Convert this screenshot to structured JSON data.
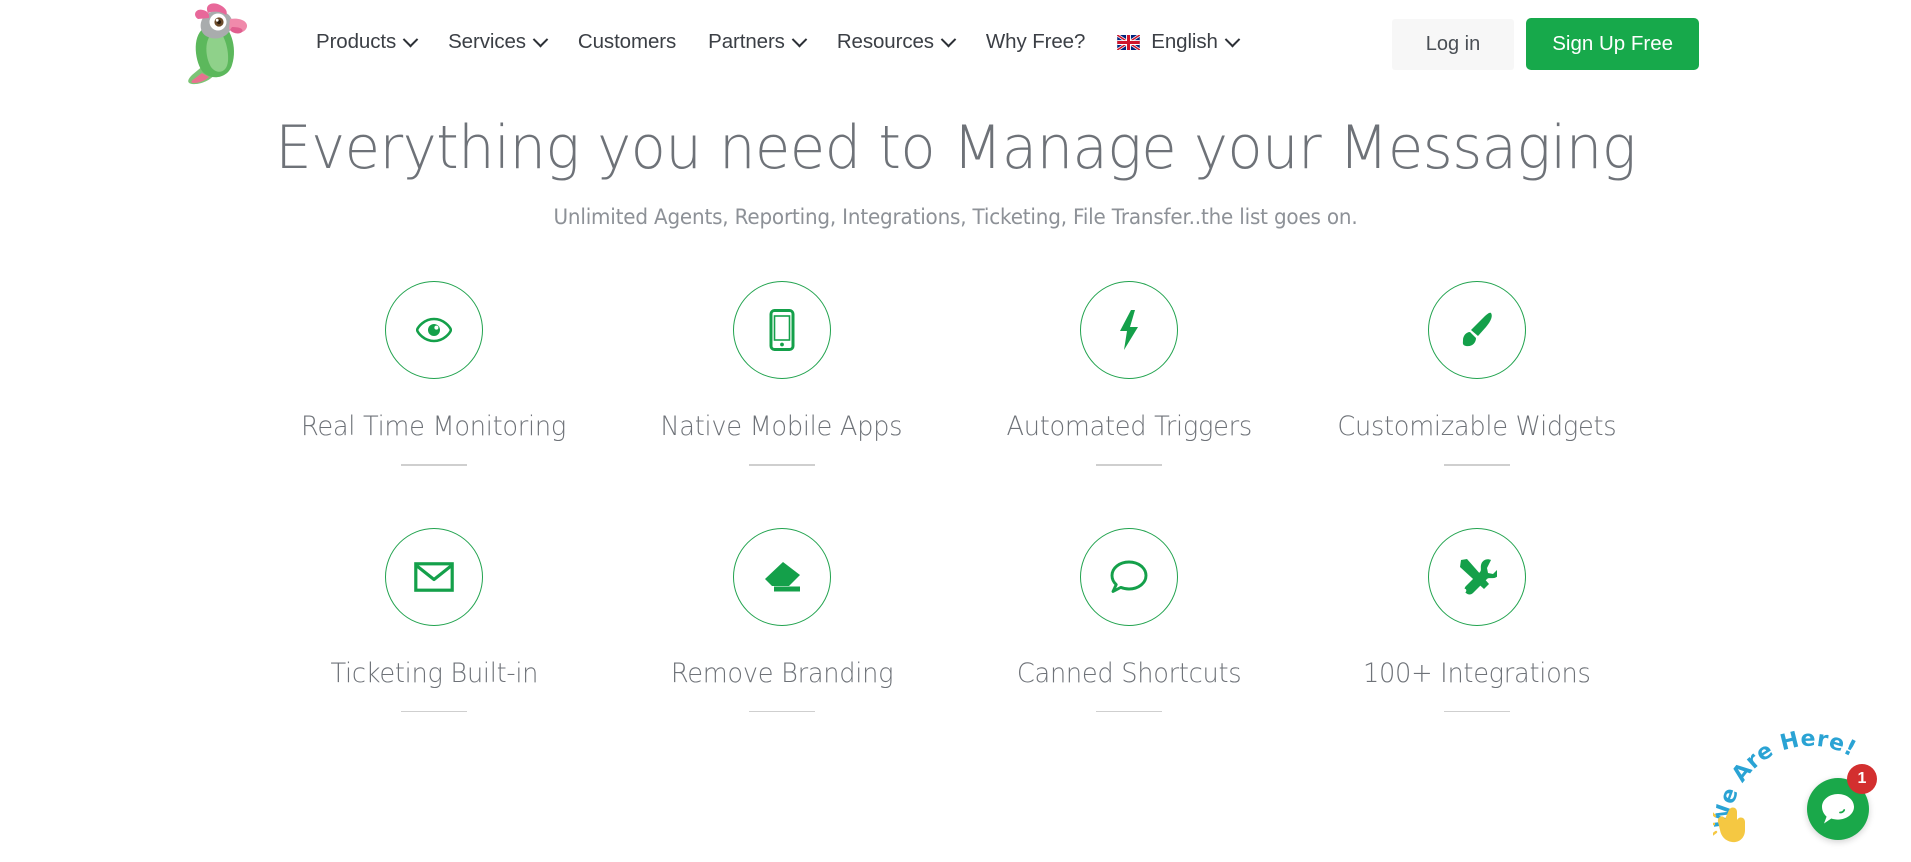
{
  "header": {
    "logo_name": "parrot-logo",
    "nav": [
      {
        "label": "Products",
        "has_dropdown": true,
        "icon": "chevron-down-icon"
      },
      {
        "label": "Services",
        "has_dropdown": true,
        "icon": "chevron-down-icon"
      },
      {
        "label": "Customers",
        "has_dropdown": false,
        "icon": ""
      },
      {
        "label": "Partners",
        "has_dropdown": true,
        "icon": "chevron-down-icon"
      },
      {
        "label": "Resources",
        "has_dropdown": true,
        "icon": "chevron-down-icon"
      },
      {
        "label": "Why Free?",
        "has_dropdown": false,
        "icon": ""
      }
    ],
    "language": {
      "label": "English",
      "flag_icon": "uk-flag-icon",
      "chevron_icon": "chevron-down-icon"
    },
    "login_label": "Log in",
    "signup_label": "Sign Up Free"
  },
  "hero": {
    "title": "Everything you need to Manage your Messaging",
    "subtitle": "Unlimited Agents, Reporting, Integrations, Ticketing, File Transfer..the list goes on."
  },
  "features": [
    {
      "label": "Real Time Monitoring",
      "icon": "eye-icon"
    },
    {
      "label": "Native Mobile Apps",
      "icon": "mobile-phone-icon"
    },
    {
      "label": "Automated Triggers",
      "icon": "lightning-bolt-icon"
    },
    {
      "label": "Customizable Widgets",
      "icon": "paintbrush-icon"
    },
    {
      "label": "Ticketing Built-in",
      "icon": "envelope-icon"
    },
    {
      "label": "Remove Branding",
      "icon": "eraser-icon"
    },
    {
      "label": "Canned Shortcuts",
      "icon": "speech-bubble-icon"
    },
    {
      "label": "100+ Integrations",
      "icon": "tools-icon"
    }
  ],
  "chat_widget": {
    "caption": "We Are Here!",
    "badge_count": "1",
    "bubble_icon": "chat-bubble-icon",
    "hand_icon": "waving-hand-icon"
  },
  "colors": {
    "brand_green": "#17a94b",
    "icon_green": "#14a04a",
    "circle_border": "#22a34f",
    "heading_gray": "#6e7278",
    "nav_text": "#3b3f45",
    "badge_red": "#d32f2f",
    "caption_blue": "#2aa3d4",
    "hand_yellow": "#f5c842"
  }
}
